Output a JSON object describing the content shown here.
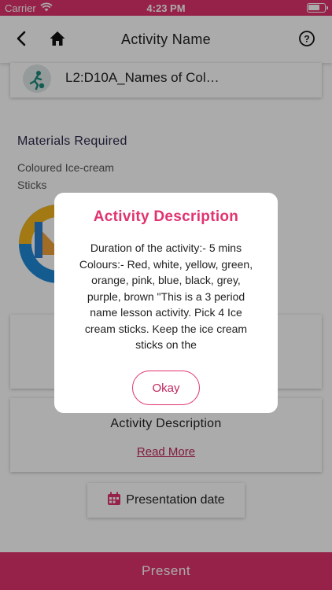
{
  "status": {
    "carrier": "Carrier",
    "time": "4:23 PM"
  },
  "nav": {
    "title": "Activity Name"
  },
  "activity": {
    "name": "L2:D10A_Names of Col…"
  },
  "materials": {
    "title": "Materials Required",
    "text": "Coloured Ice-cream Sticks"
  },
  "description_card": {
    "label": "Activity Description",
    "read_more": "Read More"
  },
  "presentation_button": {
    "label": "Presentation date"
  },
  "bottom_bar": {
    "label": "Present"
  },
  "modal": {
    "title": "Activity Description",
    "body": "Duration of the activity:- 5 mins Colours:- Red, white, yellow, green, orange, pink, blue, black, grey, purple, brown \"This is a 3 period name lesson activity. Pick 4 Ice cream sticks. Keep the ice cream sticks on the",
    "okay_label": "Okay"
  },
  "colors": {
    "accent": "#e0336f",
    "link": "#c0265c"
  }
}
